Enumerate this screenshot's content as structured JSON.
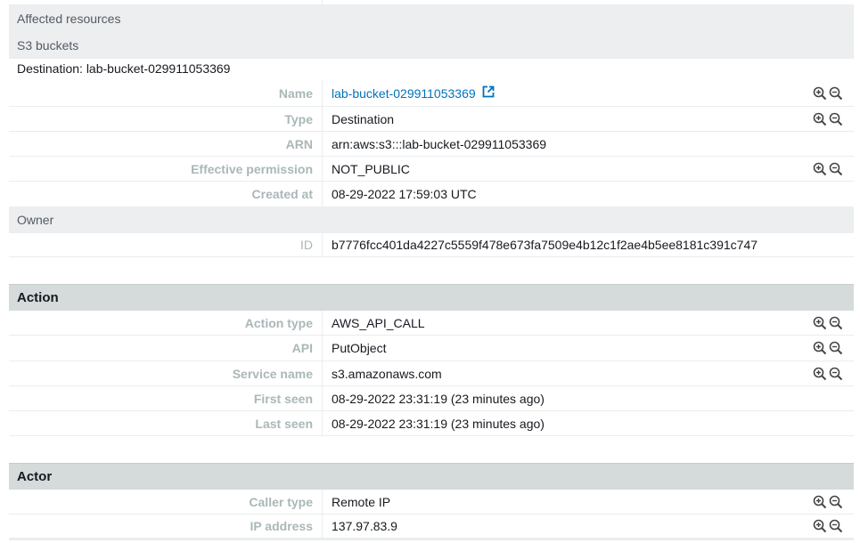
{
  "affected_resources": {
    "title": "Affected resources",
    "subtitle": "S3 buckets",
    "destination_line": "Destination: lab-bucket-029911053369",
    "rows": [
      {
        "label": "Name",
        "value": "lab-bucket-029911053369",
        "link": true,
        "zoom": true
      },
      {
        "label": "Type",
        "value": "Destination",
        "zoom": true
      },
      {
        "label": "ARN",
        "value": "arn:aws:s3:::lab-bucket-029911053369",
        "zoom": false
      },
      {
        "label": "Effective permission",
        "value": "NOT_PUBLIC",
        "zoom": true
      },
      {
        "label": "Created at",
        "value": "08-29-2022 17:59:03 UTC",
        "zoom": false
      }
    ],
    "owner": {
      "title": "Owner",
      "id_label": "ID",
      "id_value": "b7776fcc401da4227c5559f478e673fa7509e4b12c1f2ae4b5ee8181c391c747"
    }
  },
  "action": {
    "title": "Action",
    "rows": [
      {
        "label": "Action type",
        "value": "AWS_API_CALL",
        "zoom": true
      },
      {
        "label": "API",
        "value": "PutObject",
        "zoom": true
      },
      {
        "label": "Service name",
        "value": "s3.amazonaws.com",
        "zoom": true
      },
      {
        "label": "First seen",
        "value": "08-29-2022 23:31:19 (23 minutes ago)",
        "zoom": false
      },
      {
        "label": "Last seen",
        "value": "08-29-2022 23:31:19 (23 minutes ago)",
        "zoom": false
      }
    ]
  },
  "actor": {
    "title": "Actor",
    "rows": [
      {
        "label": "Caller type",
        "value": "Remote IP",
        "zoom": true
      },
      {
        "label": "IP address",
        "value": "137.97.83.9",
        "zoom": true
      }
    ]
  },
  "colors": {
    "link": "#0073bb",
    "label": "#aab7b8",
    "band": "#eceeef",
    "section_header": "#d5dbdb"
  },
  "icons": {
    "zoom_in": "zoom-in-icon",
    "zoom_out": "zoom-out-icon",
    "external_link": "external-link-icon"
  }
}
